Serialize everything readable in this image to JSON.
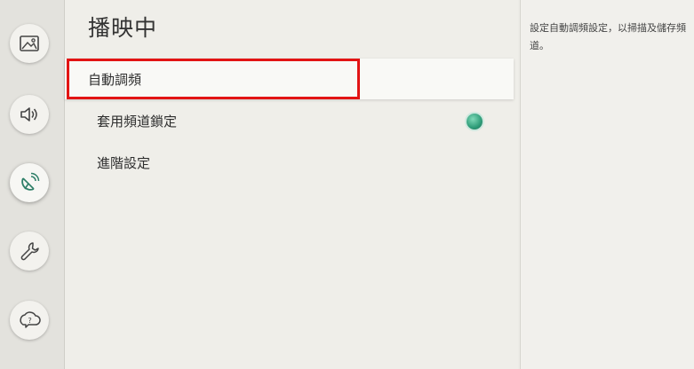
{
  "rail": {
    "items": [
      {
        "icon": "picture-icon"
      },
      {
        "icon": "sound-icon"
      },
      {
        "icon": "channel-broadcast-icon"
      },
      {
        "icon": "wrench-icon"
      },
      {
        "icon": "support-icon"
      }
    ]
  },
  "panel": {
    "title": "播映中",
    "items": [
      {
        "label": "自動調頻"
      },
      {
        "label": "套用頻道鎖定"
      },
      {
        "label": "進階設定"
      }
    ]
  },
  "help": {
    "text": "設定自動調頻設定，以掃描及儲存頻道。"
  },
  "colors": {
    "highlight": "#e21414",
    "toggle_on": "#2e9c78"
  }
}
